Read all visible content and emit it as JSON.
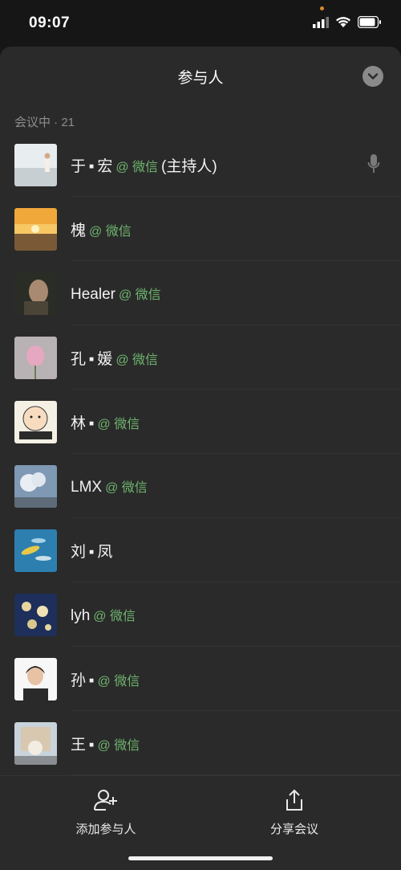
{
  "status_bar": {
    "time": "09:07"
  },
  "header": {
    "title": "参与人"
  },
  "section": {
    "label": "会议中 · 21"
  },
  "participants": [
    {
      "name": "于 ▪ 宏",
      "tag": "@ 微信",
      "role": "(主持人)",
      "avatar": "beach-photo",
      "mic": true
    },
    {
      "name": "槐",
      "tag": "@ 微信",
      "role": "",
      "avatar": "sunset-photo"
    },
    {
      "name": "Healer",
      "tag": "@ 微信",
      "role": "",
      "avatar": "portrait-photo"
    },
    {
      "name": "孔 ▪ 媛",
      "tag": "@ 微信",
      "role": "",
      "avatar": "lotus-photo"
    },
    {
      "name": "林 ▪",
      "tag": "@ 微信",
      "role": "",
      "avatar": "cartoon-photo"
    },
    {
      "name": "LMX",
      "tag": "@ 微信",
      "role": "",
      "avatar": "clouds-photo"
    },
    {
      "name": "刘 ▪ 凤",
      "tag": "",
      "role": "",
      "avatar": "fish-photo"
    },
    {
      "name": "lyh",
      "tag": "@ 微信",
      "role": "",
      "avatar": "flowers-photo"
    },
    {
      "name": "孙 ▪",
      "tag": "@ 微信",
      "role": "",
      "avatar": "woman-photo"
    },
    {
      "name": "王 ▪",
      "tag": "@ 微信",
      "role": "",
      "avatar": "bear-photo"
    }
  ],
  "actions": {
    "add_label": "添加参与人",
    "share_label": "分享会议"
  },
  "colors": {
    "accent": "#6fb46e",
    "background": "#2a2a2a"
  }
}
